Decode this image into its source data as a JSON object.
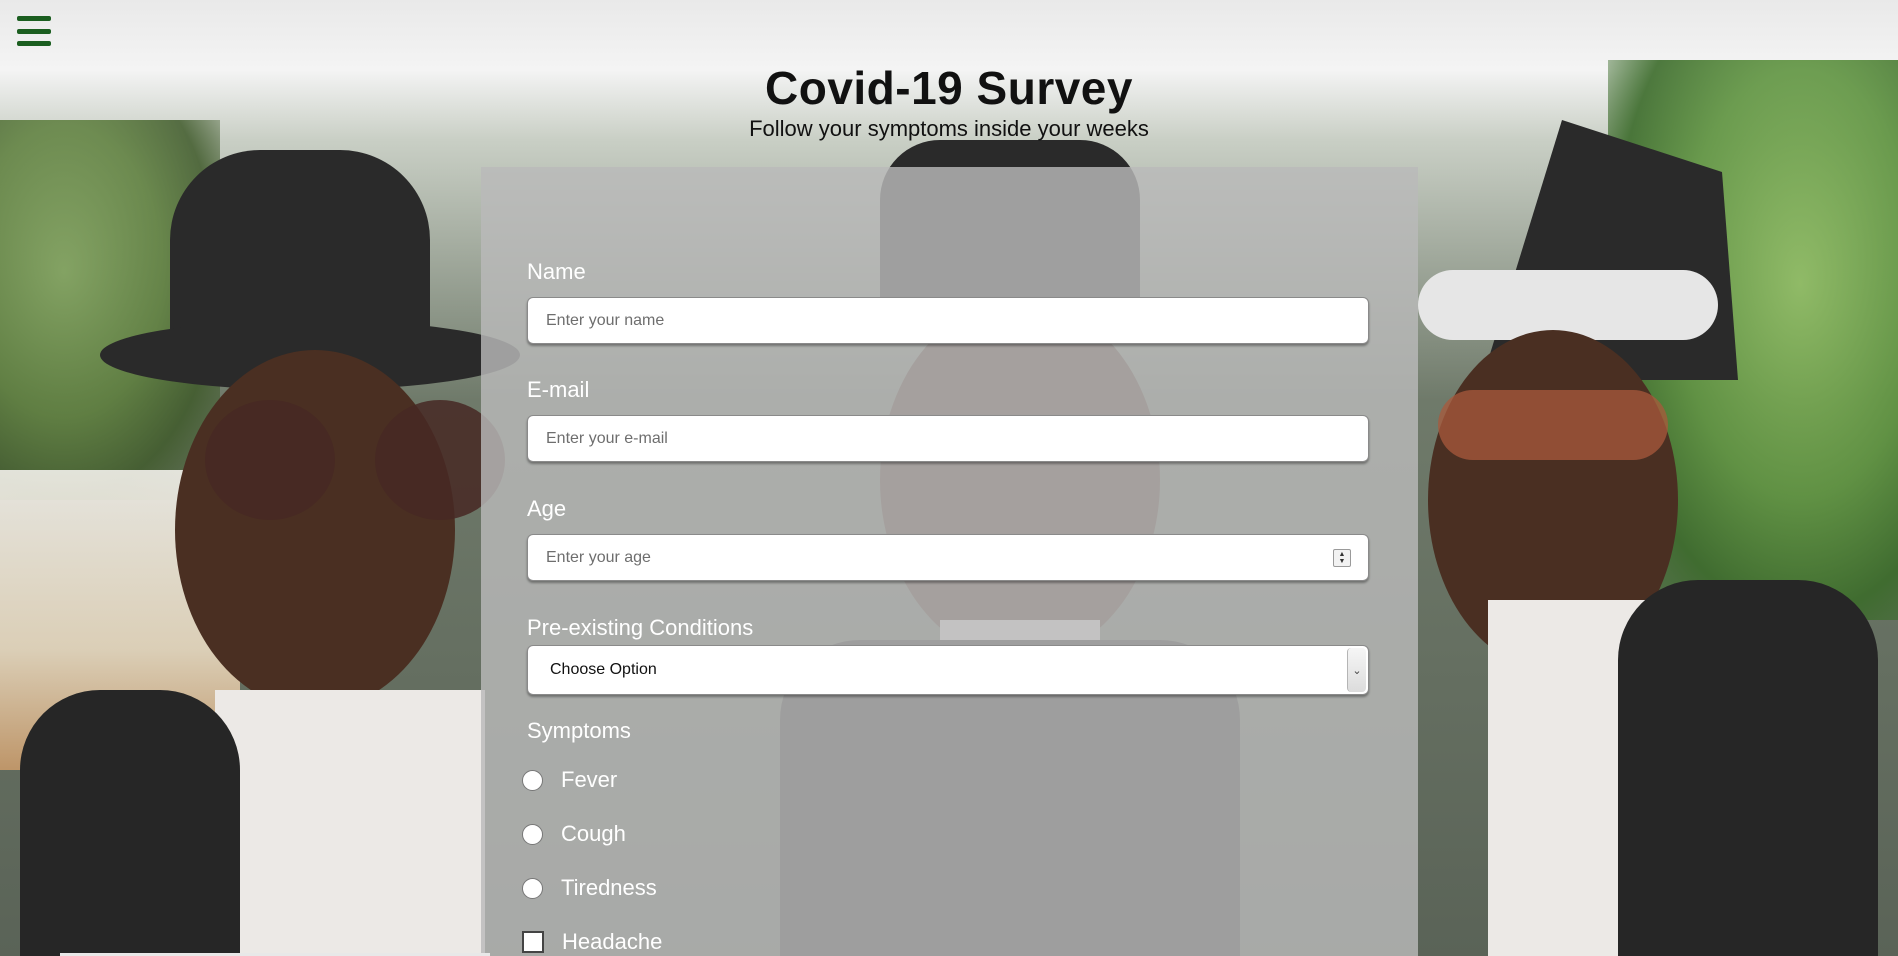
{
  "header": {
    "title": "Covid-19 Survey",
    "subtitle": "Follow your symptoms inside your weeks",
    "menu_icon": "hamburger-menu-icon"
  },
  "form": {
    "name": {
      "label": "Name",
      "placeholder": "Enter your name",
      "value": ""
    },
    "email": {
      "label": "E-mail",
      "placeholder": "Enter your e-mail",
      "value": ""
    },
    "age": {
      "label": "Age",
      "placeholder": "Enter your age",
      "value": ""
    },
    "conditions": {
      "label": "Pre-existing Conditions",
      "selected": "Choose Option"
    },
    "symptoms": {
      "label": "Symptoms",
      "options": [
        {
          "label": "Fever",
          "type": "radio",
          "checked": false
        },
        {
          "label": "Cough",
          "type": "radio",
          "checked": false
        },
        {
          "label": "Tiredness",
          "type": "radio",
          "checked": false
        },
        {
          "label": "Headache",
          "type": "checkbox",
          "checked": false
        }
      ]
    }
  },
  "colors": {
    "menu_icon": "#1b5e20",
    "panel": "rgba(185,185,185,0.82)",
    "label_text": "#ffffff"
  }
}
